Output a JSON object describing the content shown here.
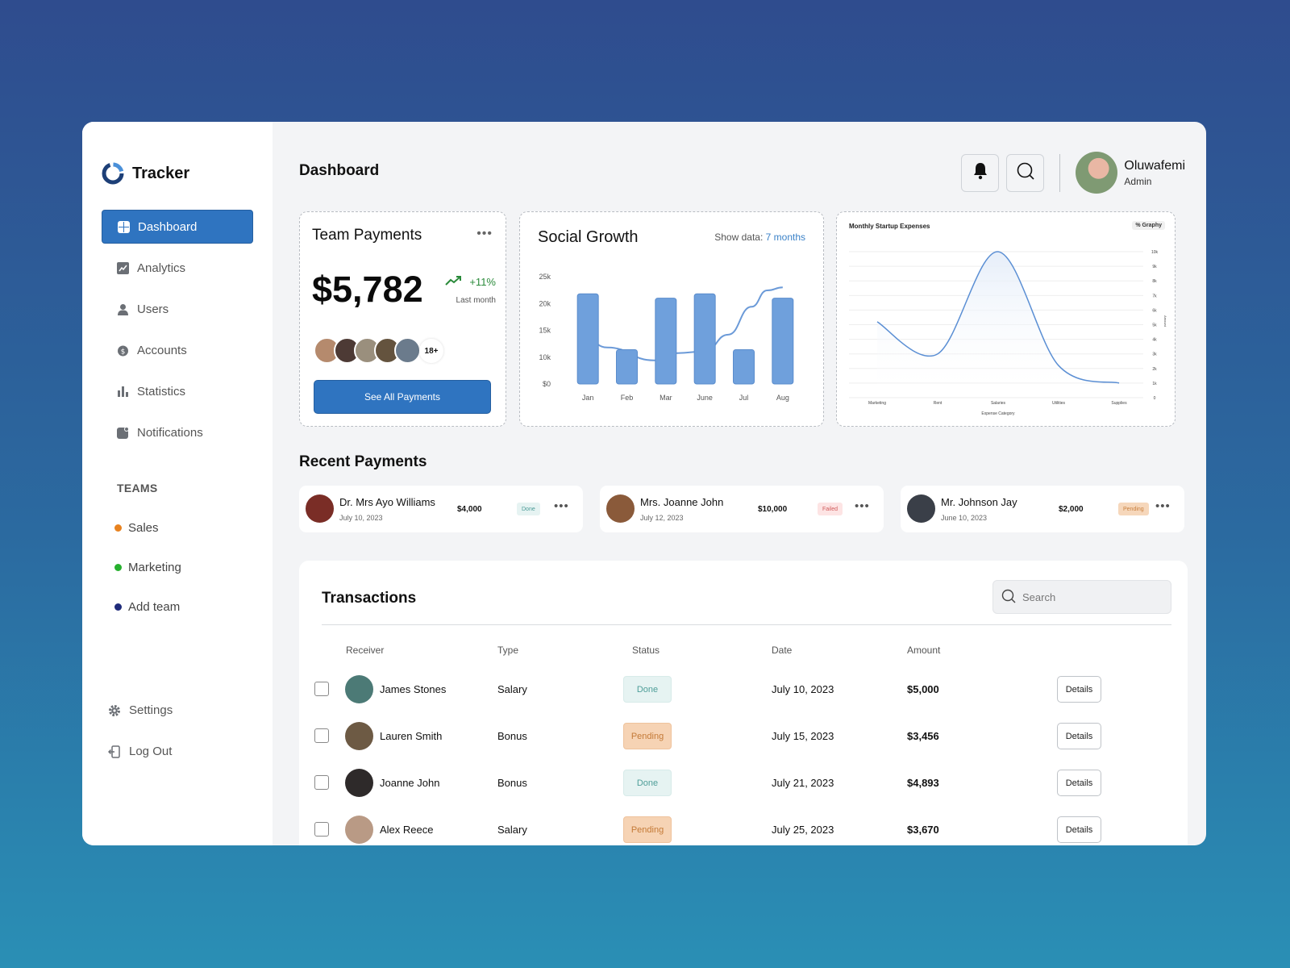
{
  "app": {
    "name": "Tracker"
  },
  "sidebar": {
    "items": [
      {
        "label": "Dashboard",
        "icon": "dashboard-icon"
      },
      {
        "label": "Analytics",
        "icon": "analytics-icon"
      },
      {
        "label": "Users",
        "icon": "user-icon"
      },
      {
        "label": "Accounts",
        "icon": "coin-icon"
      },
      {
        "label": "Statistics",
        "icon": "bar-chart-icon"
      },
      {
        "label": "Notifications",
        "icon": "notification-icon"
      }
    ],
    "teams_title": "TEAMS",
    "teams": [
      {
        "label": "Sales",
        "color": "#e8821f"
      },
      {
        "label": "Marketing",
        "color": "#26b02e"
      },
      {
        "label": "Add team",
        "color": "#1f2b7a"
      }
    ],
    "settings_label": "Settings",
    "logout_label": "Log Out"
  },
  "header": {
    "title": "Dashboard",
    "user_name": "Oluwafemi",
    "user_role": "Admin"
  },
  "team_payments": {
    "title": "Team Payments",
    "amount": "$5,782",
    "growth": "+11%",
    "growth_label": "Last month",
    "avatars_more": "18+",
    "button_label": "See All Payments"
  },
  "social_growth": {
    "title": "Social Growth",
    "show_label": "Show data:",
    "show_value": "7 months"
  },
  "expenses": {
    "title": "Monthly Startup Expenses",
    "badge": "% Graphy"
  },
  "chart_data": [
    {
      "type": "bar",
      "categories": [
        "Jan",
        "Feb",
        "Mar",
        "June",
        "Jul",
        "Aug"
      ],
      "values": [
        21000,
        8000,
        20000,
        21000,
        8000,
        20000
      ],
      "y_ticks": [
        "25k",
        "20k",
        "15k",
        "10k",
        "$0"
      ],
      "ylim": [
        0,
        25000
      ],
      "overlay_line": [
        {
          "x": 0,
          "y": 10000
        },
        {
          "x": 0.5,
          "y": 8500
        },
        {
          "x": 1.7,
          "y": 5500
        },
        {
          "x": 2.3,
          "y": 7200
        },
        {
          "x": 3.0,
          "y": 7600
        },
        {
          "x": 3.6,
          "y": 11500
        },
        {
          "x": 4.2,
          "y": 18000
        },
        {
          "x": 4.6,
          "y": 21800
        },
        {
          "x": 5.0,
          "y": 22500
        }
      ],
      "colors": {
        "bar": "#6fa0dc",
        "line": "#5b8fd4"
      }
    },
    {
      "type": "area",
      "title": "Monthly Startup Expenses",
      "categories": [
        "Marketing",
        "Rent",
        "Salaries",
        "Utilities",
        "Supplies"
      ],
      "values": [
        5200,
        3000,
        10000,
        2200,
        1000
      ],
      "xlabel": "Expense Category",
      "ylabel": "Amount",
      "y_ticks": [
        "10k",
        "9k",
        "8k",
        "7k",
        "6k",
        "5k",
        "4k",
        "3k",
        "2k",
        "1k",
        "0"
      ],
      "ylim": [
        0,
        10500
      ],
      "colors": {
        "line": "#5b8fd4",
        "fill": "#e6eef9"
      }
    }
  ],
  "recent_payments": {
    "title": "Recent Payments",
    "items": [
      {
        "name": "Dr. Mrs Ayo Williams",
        "date": "July 10, 2023",
        "amount": "$4,000",
        "status": "Done",
        "color": "#7a2d26"
      },
      {
        "name": "Mrs. Joanne John",
        "date": "July 12, 2023",
        "amount": "$10,000",
        "status": "Failed",
        "color": "#8a5a3a"
      },
      {
        "name": "Mr. Johnson Jay",
        "date": "June 10, 2023",
        "amount": "$2,000",
        "status": "Pending",
        "color": "#3a3f48"
      }
    ]
  },
  "transactions": {
    "title": "Transactions",
    "search_placeholder": "Search",
    "columns": [
      "Receiver",
      "Type",
      "Status",
      "Date",
      "Amount"
    ],
    "details_label": "Details",
    "rows": [
      {
        "receiver": "James Stones",
        "type": "Salary",
        "status": "Done",
        "date": "July 10, 2023",
        "amount": "$5,000",
        "color": "#4c7a76"
      },
      {
        "receiver": "Lauren Smith",
        "type": "Bonus",
        "status": "Pending",
        "date": "July 15, 2023",
        "amount": "$3,456",
        "color": "#6d5a44"
      },
      {
        "receiver": "Joanne John",
        "type": "Bonus",
        "status": "Done",
        "date": "July 21, 2023",
        "amount": "$4,893",
        "color": "#2e2a2a"
      },
      {
        "receiver": "Alex Reece",
        "type": "Salary",
        "status": "Pending",
        "date": "July 25, 2023",
        "amount": "$3,670",
        "color": "#b99a85"
      }
    ]
  },
  "team_avatar_colors": [
    "#b58a6d",
    "#4d3a35",
    "#9a8f7d",
    "#64533e",
    "#6b7b8c"
  ]
}
